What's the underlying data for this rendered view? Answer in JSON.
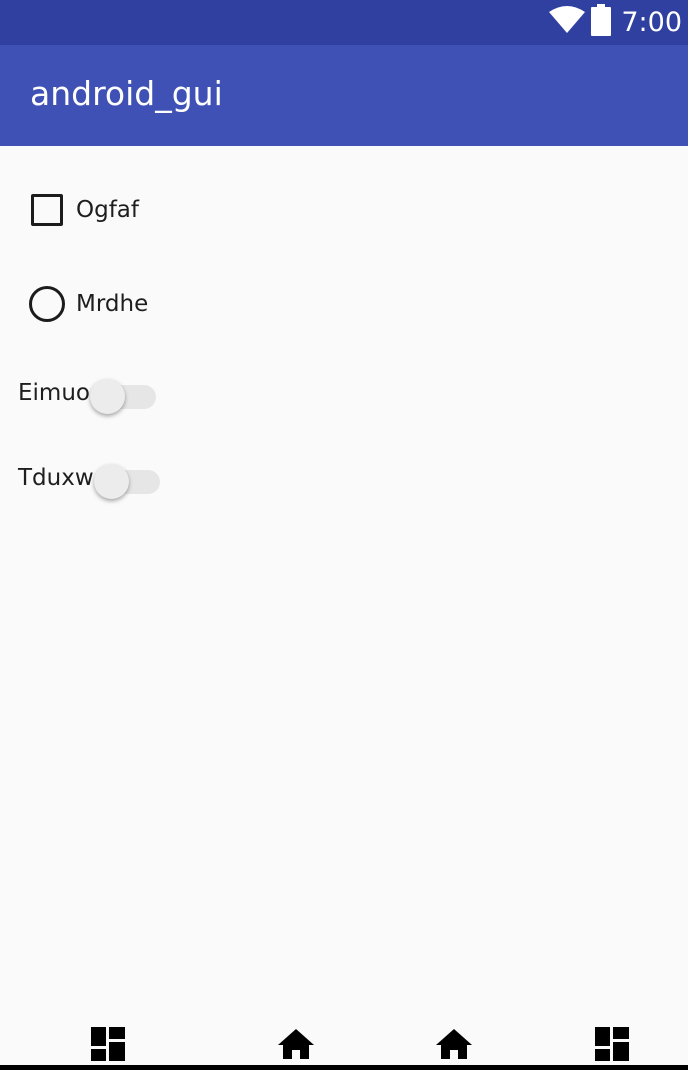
{
  "status_bar": {
    "time": "7:00",
    "icons": [
      "wifi-icon",
      "battery-icon"
    ],
    "background": "#3040a0"
  },
  "app_bar": {
    "title": "android_gui",
    "background": "#3f51b5"
  },
  "controls": {
    "checkbox": {
      "label": "Ogfaf",
      "checked": false
    },
    "radio": {
      "label": "Mrdhe",
      "selected": false
    },
    "switches": [
      {
        "label": "Eimuo",
        "on": false
      },
      {
        "label": "Tduxw",
        "on": false
      }
    ]
  },
  "nav_bar": {
    "icons": [
      "dashboard-icon",
      "home-icon",
      "home-icon",
      "dashboard-icon"
    ]
  }
}
